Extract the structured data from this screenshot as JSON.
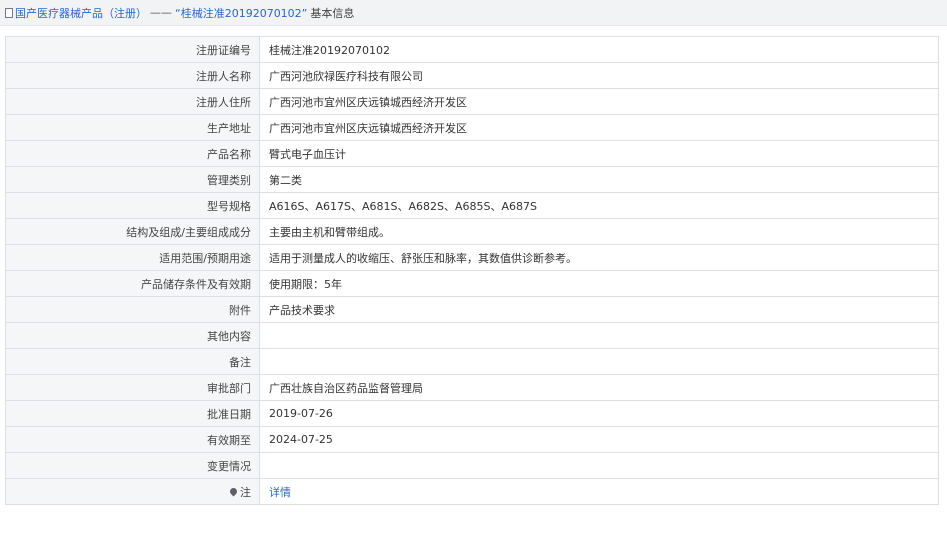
{
  "breadcrumb": {
    "icon": "document-icon",
    "root": "国产医疗器械产品（注册）",
    "separator": "——",
    "current": "“桂械注准20192070102”",
    "tail": "基本信息"
  },
  "rows": [
    {
      "label": "注册证编号",
      "value": "桂械注准20192070102"
    },
    {
      "label": "注册人名称",
      "value": "广西河池欣禄医疗科技有限公司"
    },
    {
      "label": "注册人住所",
      "value": "广西河池市宜州区庆远镇城西经济开发区"
    },
    {
      "label": "生产地址",
      "value": "广西河池市宜州区庆远镇城西经济开发区"
    },
    {
      "label": "产品名称",
      "value": "臂式电子血压计"
    },
    {
      "label": "管理类别",
      "value": "第二类"
    },
    {
      "label": "型号规格",
      "value": "A616S、A617S、A681S、A682S、A685S、A687S"
    },
    {
      "label": "结构及组成/主要组成成分",
      "value": "主要由主机和臂带组成。"
    },
    {
      "label": "适用范围/预期用途",
      "value": "适用于测量成人的收缩压、舒张压和脉率，其数值供诊断参考。"
    },
    {
      "label": "产品储存条件及有效期",
      "value": "使用期限：5年"
    },
    {
      "label": "附件",
      "value": "产品技术要求"
    },
    {
      "label": "其他内容",
      "value": ""
    },
    {
      "label": "备注",
      "value": ""
    },
    {
      "label": "审批部门",
      "value": "广西壮族自治区药品监督管理局"
    },
    {
      "label": "批准日期",
      "value": "2019-07-26"
    },
    {
      "label": "有效期至",
      "value": "2024-07-25"
    },
    {
      "label": "变更情况",
      "value": ""
    }
  ],
  "note_row": {
    "icon": "pin-icon",
    "label": "注",
    "link": "详情"
  },
  "colors": {
    "link": "#2a66c9",
    "label_bg": "#f5f6f8",
    "border": "#dcdfe6",
    "topbar_bg": "#f2f3f5"
  }
}
